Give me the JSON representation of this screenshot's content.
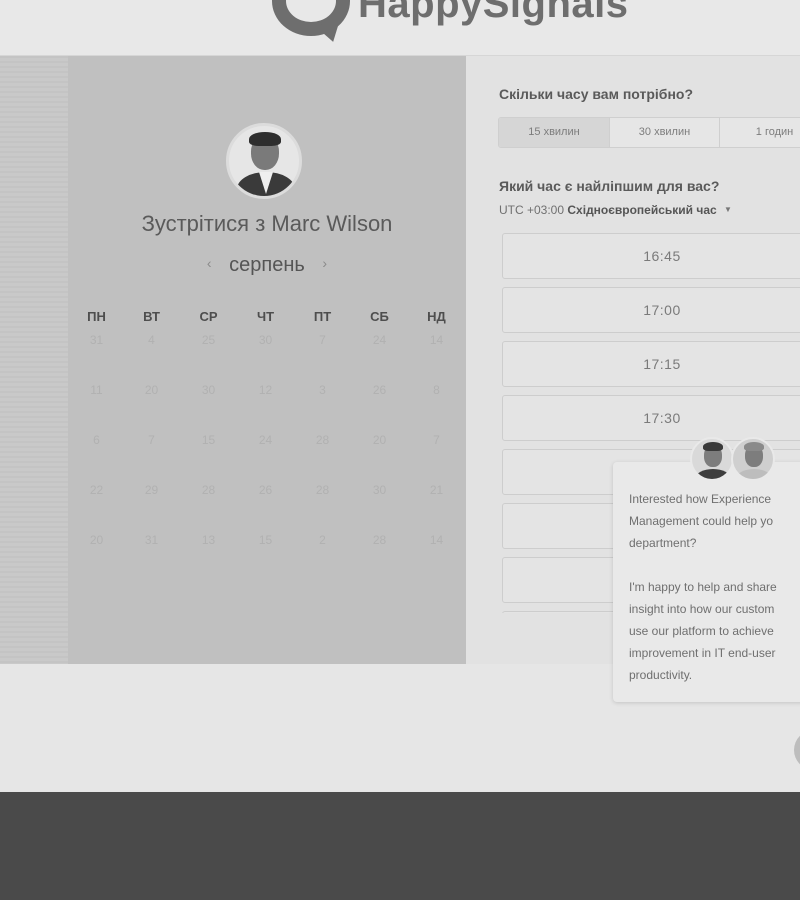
{
  "brand": {
    "name": "HappySignals"
  },
  "host": {
    "title_prefix": "Зустрітися з",
    "title_name": "Marc Wilson"
  },
  "calendar": {
    "month": "серпень",
    "prev_icon": "chevron-left-icon",
    "next_icon": "chevron-right-icon",
    "weekdays": [
      "ПН",
      "ВТ",
      "СР",
      "ЧТ",
      "ПТ",
      "СБ",
      "НД"
    ],
    "weeks": [
      [
        "31",
        "4",
        "25",
        "30",
        "7",
        "24",
        "14"
      ],
      [
        "11",
        "20",
        "30",
        "12",
        "3",
        "26",
        "8"
      ],
      [
        "6",
        "7",
        "15",
        "24",
        "28",
        "20",
        "7"
      ],
      [
        "22",
        "29",
        "28",
        "26",
        "28",
        "30",
        "21"
      ],
      [
        "20",
        "31",
        "13",
        "15",
        "2",
        "28",
        "14"
      ]
    ]
  },
  "duration": {
    "question": "Скільки часу вам потрібно?",
    "options": [
      "15 хвилин",
      "30 хвилин",
      "1 годин"
    ],
    "selected": "15 хвилин"
  },
  "time": {
    "question": "Який час є найліпшим для вас?",
    "timezone_offset": "UTC +03:00",
    "timezone_name": "Східноєвропейський час",
    "slots": [
      "16:45",
      "17:00",
      "17:15",
      "17:30",
      "",
      "",
      "",
      ""
    ]
  },
  "chat": {
    "lines_1": [
      "Interested how Experience",
      "Management could help yo",
      "department?"
    ],
    "lines_2": [
      "I'm happy to help and share",
      "insight into how our custom",
      "use our platform to achieve",
      "improvement in IT end-user",
      "productivity."
    ]
  },
  "colors": {
    "page_bg": "#e6e6e6",
    "left_panel": "#c0c0c0",
    "footer": "#4a4a4a"
  }
}
